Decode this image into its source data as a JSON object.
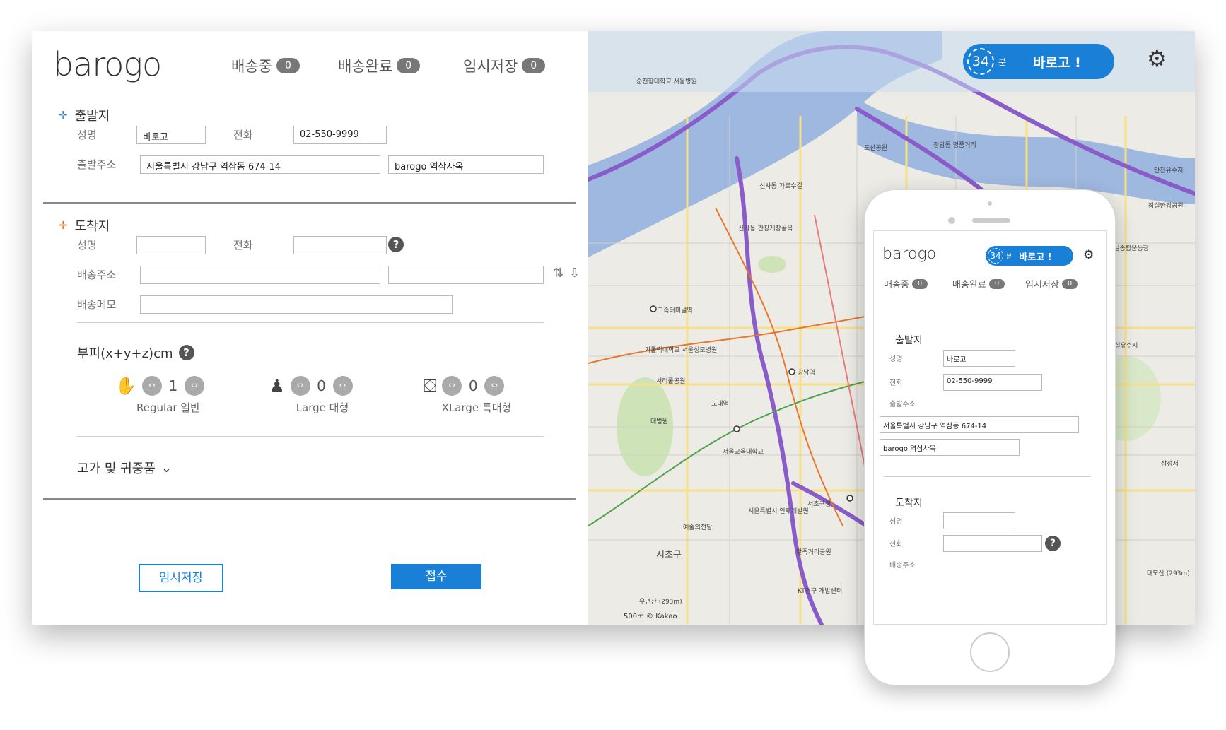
{
  "app": {
    "logo": "barogo",
    "tabs": [
      {
        "label": "배송중",
        "count": "0"
      },
      {
        "label": "배송완료",
        "count": "0"
      },
      {
        "label": "임시저장",
        "count": "0"
      }
    ]
  },
  "origin": {
    "title": "출발지",
    "name_label": "성명",
    "name_value": "바로고",
    "phone_label": "전화",
    "phone_value": "02-550-9999",
    "address_label": "출발주소",
    "address_value": "서울특별시 강남구 역삼동  674-14",
    "address_detail": "barogo 역삼사옥"
  },
  "destination": {
    "title": "도착지",
    "name_label": "성명",
    "phone_label": "전화",
    "address_label": "배송주소",
    "memo_label": "배송메모"
  },
  "volume": {
    "title": "부피(x+y+z)cm",
    "sizes": [
      {
        "count": "1",
        "label": "Regular 일반"
      },
      {
        "count": "0",
        "label": "Large 대형"
      },
      {
        "count": "0",
        "label": "XLarge 특대형"
      }
    ]
  },
  "valuables": {
    "title": "고가 및 귀중품"
  },
  "buttons": {
    "temp_save": "임시저장",
    "submit": "접수"
  },
  "badge_timer": {
    "minutes": "34",
    "unit": "분",
    "go": "바로고 !"
  },
  "map": {
    "labels": [
      "순천향대학교 서울병원",
      "도산공원",
      "청담동 명품거리",
      "신사동 가로수길",
      "신사동 간장게장골목",
      "고속터미널역",
      "가톨릭대학교 서울성모병원",
      "서리풀공원",
      "강남역",
      "교대역",
      "대법원",
      "서울교육대학교",
      "서초구청",
      "서울특별시 인재개발원",
      "예술의전당",
      "서초구",
      "말죽거리공원",
      "KT연구 개발센터",
      "우면산 (293m)",
      "대모산 (293m)",
      "탄천유수지",
      "잠실한강공원",
      "잠실유수지",
      "잠실종합운동장",
      "삼성서"
    ],
    "scale": "500m",
    "copyright": "© Kakao"
  },
  "phone": {
    "logo": "barogo",
    "tabs": [
      {
        "label": "배송중",
        "count": "0"
      },
      {
        "label": "배송완료",
        "count": "0"
      },
      {
        "label": "임시저장",
        "count": "0"
      }
    ],
    "origin_title": "출발지",
    "name_label": "성명",
    "name_value": "바로고",
    "phone_label": "전화",
    "phone_value": "02-550-9999",
    "address_label": "출발주소",
    "address_value": "서울특별시 강남구 역삼동  674-14",
    "address_detail": "barogo 역삼사옥",
    "dest_title": "도착지",
    "dest_name_label": "성명",
    "dest_phone_label": "전화",
    "dest_address_label": "배송주소"
  },
  "colors": {
    "accent": "#1a7fd6",
    "badge": "#777777",
    "origin_arrow": "#3a84d9",
    "dest_arrow": "#e8782b",
    "route_purple": "#8a5cc9",
    "river": "#9fb8e0"
  }
}
